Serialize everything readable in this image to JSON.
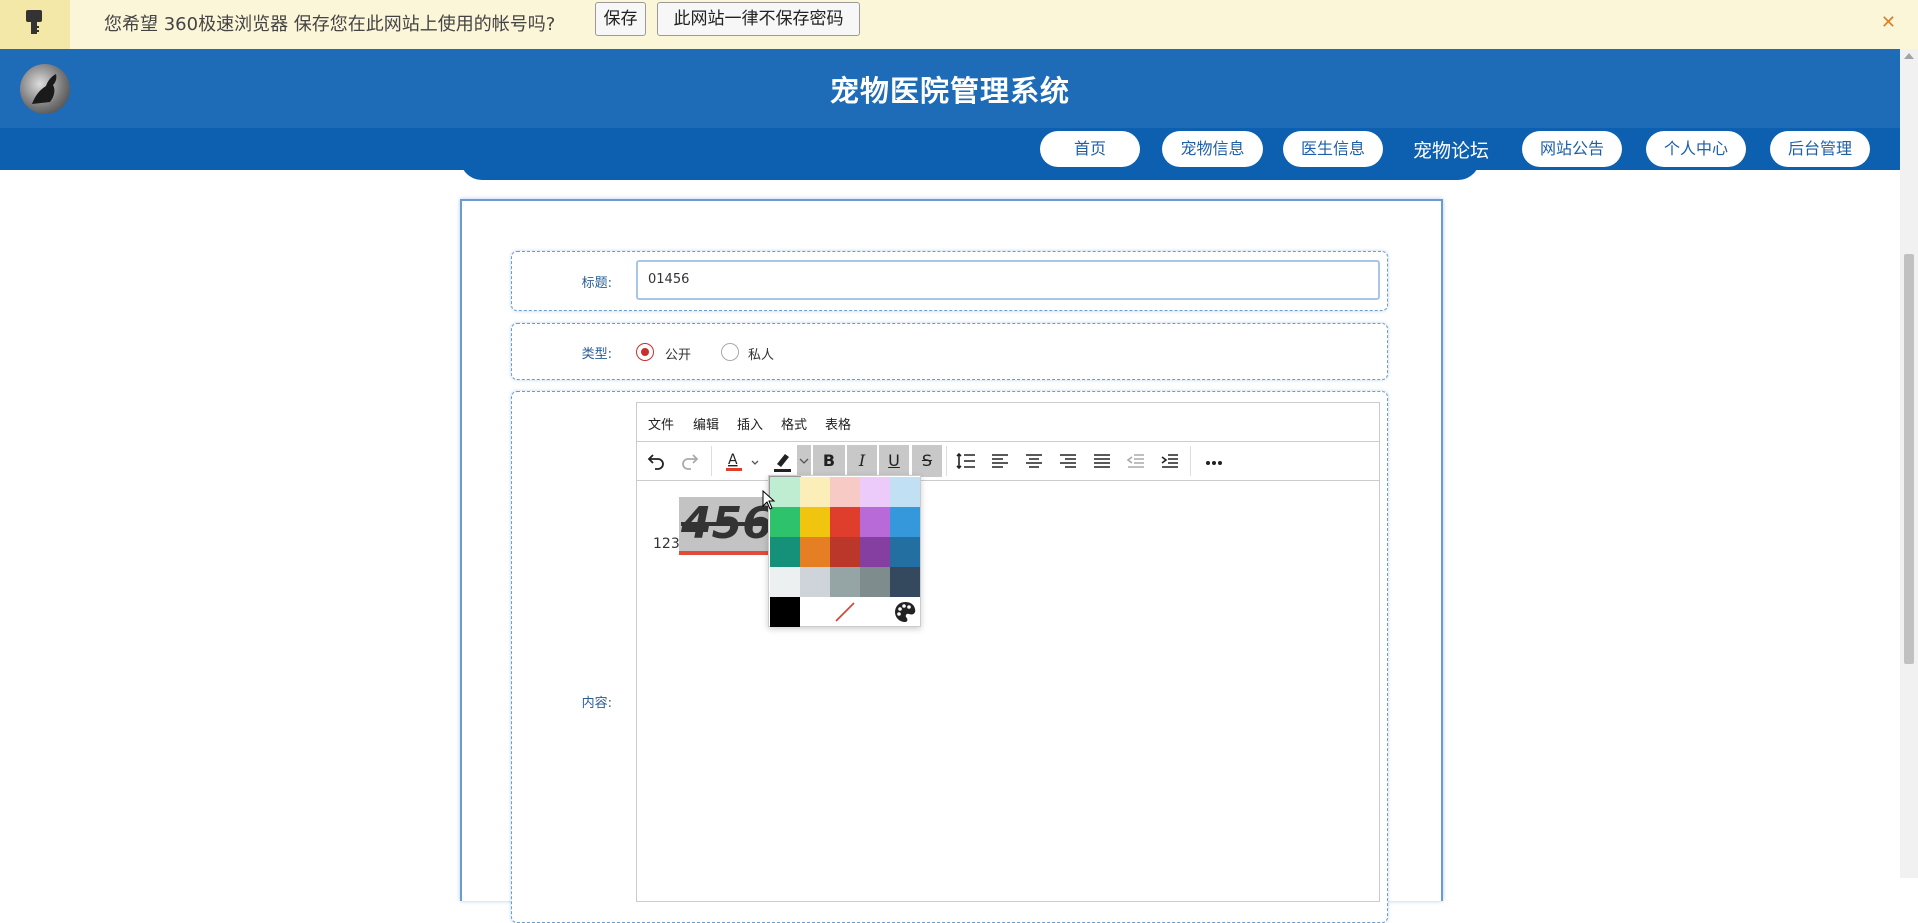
{
  "password_bar": {
    "message": "您希望 360极速浏览器 保存您在此网站上使用的帐号吗?",
    "save_label": "保存",
    "never_label": "此网站一律不保存密码",
    "close_glyph": "✕"
  },
  "header": {
    "title": "宠物医院管理系统"
  },
  "nav": {
    "items": [
      {
        "label": "首页"
      },
      {
        "label": "宠物信息"
      },
      {
        "label": "医生信息"
      },
      {
        "label": "宠物论坛"
      },
      {
        "label": "网站公告"
      },
      {
        "label": "个人中心"
      },
      {
        "label": "后台管理"
      }
    ],
    "active_index": 3
  },
  "form": {
    "title_label": "标题:",
    "title_value": "01456",
    "type_label": "类型:",
    "type_options": [
      {
        "label": "公开",
        "checked": true
      },
      {
        "label": "私人",
        "checked": false
      }
    ],
    "content_label": "内容:"
  },
  "editor": {
    "menus": [
      "文件",
      "编辑",
      "插入",
      "格式",
      "表格"
    ],
    "content": {
      "plain_text": "123",
      "styled_text": "456"
    },
    "toolbar_icons": [
      "undo-icon",
      "redo-icon",
      "text-color-icon",
      "highlight-icon",
      "bold-icon",
      "italic-icon",
      "underline-icon",
      "strikethrough-icon",
      "line-height-icon",
      "align-left-icon",
      "align-center-icon",
      "align-right-icon",
      "align-justify-icon",
      "outdent-icon",
      "indent-icon",
      "more-icon"
    ]
  },
  "color_picker": {
    "swatches": [
      "#bfedd2",
      "#fbeeb8",
      "#f8cac6",
      "#eccafa",
      "#c2e0f4",
      "#2dc26b",
      "#f1c40f",
      "#e03e2d",
      "#b96ad9",
      "#3598db",
      "#169179",
      "#e67e23",
      "#ba372a",
      "#843fa1",
      "#236fa1",
      "#ecf0f1",
      "#ced4d9",
      "#95a5a6",
      "#7e8c8d",
      "#34495e",
      "#000000"
    ]
  },
  "colors": {
    "header_bg": "#1e6bb8",
    "nav_bg": "#0d5fb0",
    "password_bar_bg": "#fcf6d9",
    "accent_red": "#c9302c"
  }
}
